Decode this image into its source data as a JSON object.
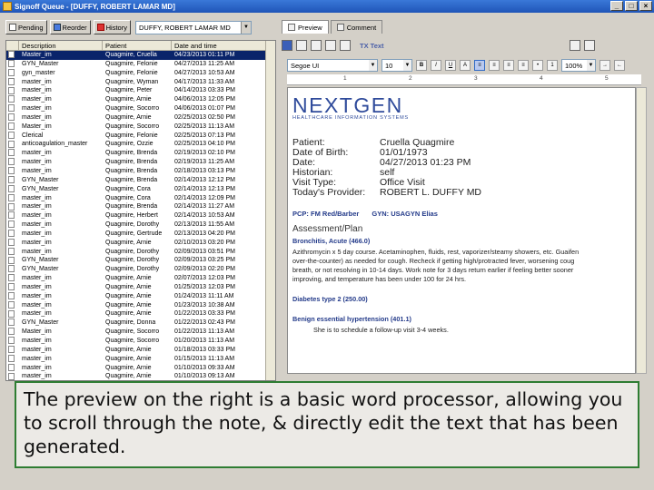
{
  "window": {
    "title": "Signoff Queue - [DUFFY, ROBERT LAMAR MD]"
  },
  "left": {
    "toolbar": {
      "pending": "Pending",
      "reorder": "Reorder",
      "history": "History",
      "patient": "DUFFY, ROBERT LAMAR MD"
    },
    "columns": [
      "Description",
      "Patient",
      "Date and time"
    ],
    "rows": [
      {
        "desc": "Master_im",
        "patient": "Quagmire, Cruella",
        "date": "04/23/2013 01:11 PM"
      },
      {
        "desc": "GYN_Master",
        "patient": "Quagmire, Felonie",
        "date": "04/27/2013 11:25 AM"
      },
      {
        "desc": "gyn_master",
        "patient": "Quagmire, Felonie",
        "date": "04/27/2013 10:53 AM"
      },
      {
        "desc": "master_im",
        "patient": "Quagmire, Wyman",
        "date": "04/17/2013 11:33 AM"
      },
      {
        "desc": "master_im",
        "patient": "Quagmire, Peter",
        "date": "04/14/2013 03:33 PM"
      },
      {
        "desc": "master_im",
        "patient": "Quagmire, Arnie",
        "date": "04/06/2013 12:05 PM"
      },
      {
        "desc": "master_im",
        "patient": "Quagmire, Socorro",
        "date": "04/06/2013 01:07 PM"
      },
      {
        "desc": "master_im",
        "patient": "Quagmire, Arnie",
        "date": "02/25/2013 02:50 PM"
      },
      {
        "desc": "Master_im",
        "patient": "Quagmire, Socorro",
        "date": "02/25/2013 11:13 AM"
      },
      {
        "desc": "Clerical",
        "patient": "Quagmire, Felonie",
        "date": "02/25/2013 07:13 PM"
      },
      {
        "desc": "anticoagulation_master",
        "patient": "Quagmire, Ozzie",
        "date": "02/25/2013 04:10 PM"
      },
      {
        "desc": "master_im",
        "patient": "Quagmire, Brenda",
        "date": "02/19/2013 02:10 PM"
      },
      {
        "desc": "master_im",
        "patient": "Quagmire, Brenda",
        "date": "02/19/2013 11:25 AM"
      },
      {
        "desc": "master_im",
        "patient": "Quagmire, Brenda",
        "date": "02/18/2013 03:13 PM"
      },
      {
        "desc": "GYN_Master",
        "patient": "Quagmire, Brenda",
        "date": "02/14/2013 12:12 PM"
      },
      {
        "desc": "GYN_Master",
        "patient": "Quagmire, Cora",
        "date": "02/14/2013 12:13 PM"
      },
      {
        "desc": "master_im",
        "patient": "Quagmire, Cora",
        "date": "02/14/2013 12:09 PM"
      },
      {
        "desc": "master_im",
        "patient": "Quagmire, Brenda",
        "date": "02/14/2013 11:27 AM"
      },
      {
        "desc": "master_im",
        "patient": "Quagmire, Herbert",
        "date": "02/14/2013 10:53 AM"
      },
      {
        "desc": "master_im",
        "patient": "Quagmire, Dorothy",
        "date": "02/13/2013 11:55 AM"
      },
      {
        "desc": "master_im",
        "patient": "Quagmire, Gertrude",
        "date": "02/13/2013 04:20 PM"
      },
      {
        "desc": "master_im",
        "patient": "Quagmire, Arnie",
        "date": "02/10/2013 03:20 PM"
      },
      {
        "desc": "master_im",
        "patient": "Quagmire, Dorothy",
        "date": "02/09/2013 03:51 PM"
      },
      {
        "desc": "GYN_Master",
        "patient": "Quagmire, Dorothy",
        "date": "02/09/2013 03:25 PM"
      },
      {
        "desc": "GYN_Master",
        "patient": "Quagmire, Dorothy",
        "date": "02/09/2013 02:20 PM"
      },
      {
        "desc": "master_im",
        "patient": "Quagmire, Arnie",
        "date": "02/07/2013 12:03 PM"
      },
      {
        "desc": "master_im",
        "patient": "Quagmire, Arnie",
        "date": "01/25/2013 12:03 PM"
      },
      {
        "desc": "master_im",
        "patient": "Quagmire, Arnie",
        "date": "01/24/2013 11:11 AM"
      },
      {
        "desc": "master_im",
        "patient": "Quagmire, Arnie",
        "date": "01/23/2013 10:38 AM"
      },
      {
        "desc": "master_im",
        "patient": "Quagmire, Arnie",
        "date": "01/22/2013 03:33 PM"
      },
      {
        "desc": "GYN_Master",
        "patient": "Quagmire, Donna",
        "date": "01/22/2013 02:43 PM"
      },
      {
        "desc": "Master_im",
        "patient": "Quagmire, Socorro",
        "date": "01/22/2013 11:13 AM"
      },
      {
        "desc": "master_im",
        "patient": "Quagmire, Socorro",
        "date": "01/20/2013 11:13 AM"
      },
      {
        "desc": "master_im",
        "patient": "Quagmire, Arnie",
        "date": "01/18/2013 03:33 PM"
      },
      {
        "desc": "master_im",
        "patient": "Quagmire, Arnie",
        "date": "01/15/2013 11:13 AM"
      },
      {
        "desc": "master_im",
        "patient": "Quagmire, Arnie",
        "date": "01/10/2013 09:33 AM"
      },
      {
        "desc": "master_im",
        "patient": "Quagmire, Arnie",
        "date": "01/10/2013 09:13 AM"
      }
    ]
  },
  "right": {
    "tabs": {
      "preview": "Preview",
      "comment": "Comment"
    },
    "toolbar": {
      "tx_text": "TX Text",
      "font": "Segoe UI",
      "size": "10",
      "zoom": "100%"
    },
    "ruler": [
      "1",
      "2",
      "3",
      "4",
      "5"
    ],
    "doc": {
      "logo_word": "NEXTGEN",
      "logo_sub": "HEALTHCARE INFORMATION SYSTEMS",
      "fields": [
        {
          "label": "Patient:",
          "value": "Cruella Quagmire"
        },
        {
          "label": "Date of Birth:",
          "value": "01/01/1973"
        },
        {
          "label": "Date:",
          "value": "04/27/2013 01:23 PM"
        },
        {
          "label": "Historian:",
          "value": "self"
        },
        {
          "label": "Visit Type:",
          "value": "Office Visit"
        },
        {
          "label": "Today's Provider:",
          "value": "ROBERT L. DUFFY MD"
        }
      ],
      "pcp": "PCP: FM Red/Barber",
      "gyn": "GYN: USAGYN Elias",
      "assessment_title": "Assessment/Plan",
      "lines": [
        {
          "text": "Bronchitis, Acute (466.0)",
          "bold": true
        },
        {
          "text": "Azithromycin x 5 day course. Acetaminophen, fluids, rest, vaporizer/steamy showers, etc. Guaifen",
          "bold": false
        },
        {
          "text": "over-the-counter) as needed for cough. Recheck if getting high/protracted fever, worsening coug",
          "bold": false
        },
        {
          "text": "breath, or not resolving in 10-14 days. Work note for 3 days return earlier if feeling better sooner",
          "bold": false
        },
        {
          "text": "improving, and temperature has been under 100 for 24 hrs.",
          "bold": false
        },
        {
          "text": "Diabetes type 2 (250.00)",
          "bold": true
        },
        {
          "text": "Benign essential hypertension (401.1)",
          "bold": true
        },
        {
          "text": "She is to schedule a follow-up visit 3-4 weeks.",
          "bold": false
        }
      ]
    }
  },
  "caption": "The preview on the right is a basic word processor, allowing you to scroll through the note, & directly edit the text that has been generated."
}
